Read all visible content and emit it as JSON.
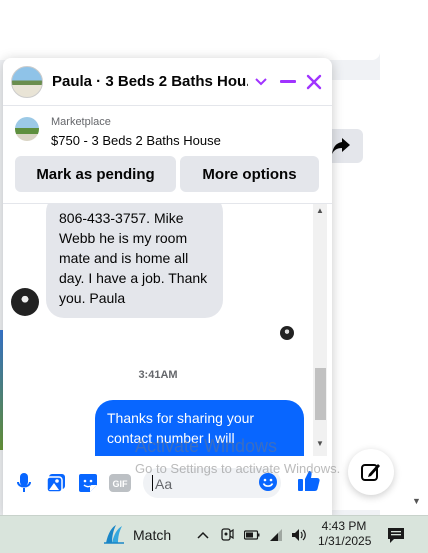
{
  "chat": {
    "title": "Paula · 3 Beds 2 Baths Hou...",
    "accent_color": "#a033ff"
  },
  "listing": {
    "source": "Marketplace",
    "title": "$750 - 3 Beds 2 Baths House",
    "mark_pending_label": "Mark as pending",
    "more_options_label": "More options"
  },
  "messages": {
    "incoming_text": "806-433-3757. Mike Webb he is my room mate and is home all day.  I have a job. Thank you. Paula",
    "timestamp": "3:41AM",
    "outgoing_text": "Thanks for sharing your contact number I will"
  },
  "composer": {
    "placeholder": "Aa",
    "icons": [
      "microphone-icon",
      "photo-icon",
      "sticker-icon",
      "gif-icon",
      "emoji-icon",
      "like-icon"
    ],
    "gif_label": "GIF"
  },
  "watermark": {
    "line1": "Activate Windows",
    "line2": "Go to Settings to activate Windows."
  },
  "taskbar": {
    "app_label": "Match",
    "time": "4:43 PM",
    "date": "1/31/2025"
  },
  "colors": {
    "messenger_blue": "#0866ff",
    "bubble_gray": "#e4e6eb"
  }
}
